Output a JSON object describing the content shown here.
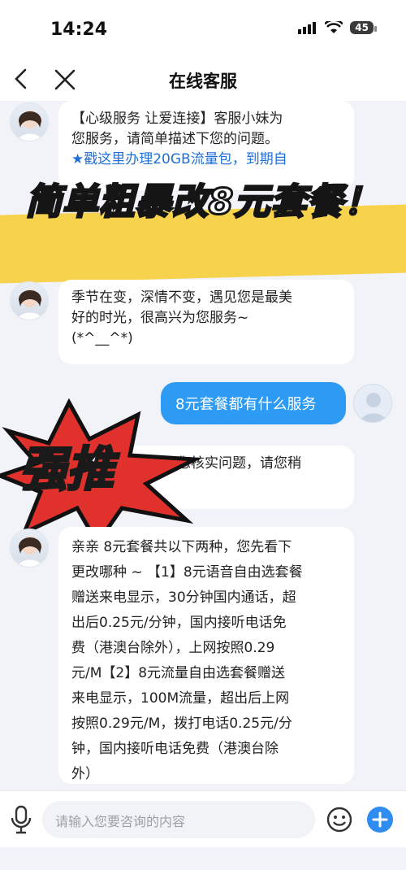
{
  "status": {
    "time": "14:24",
    "battery": "45"
  },
  "nav": {
    "title": "在线客服"
  },
  "messages": {
    "m1_line1": "【心级服务 让爱连接】客服小妹为",
    "m1_line2": "您服务，请简单描述下您的问题。",
    "m1_link": "★戳这里办理20GB流量包，到期自",
    "m2_line1": "季节在变，深情不变，遇见您是最美",
    "m2_line2": "好的时光，很高兴为您服务~",
    "m2_line3": "(*^__^*)",
    "user_msg": "8元套餐都有什么服务",
    "m3_line1": "您核实问题，请您稍",
    "m4_line1": "亲亲 8元套餐共以下两种，您先看下",
    "m4_line2": "更改哪种 ~ 【1】8元语音自由选套餐",
    "m4_line3": "赠送来电显示，30分钟国内通话，超",
    "m4_line4": "出后0.25元/分钟，国内接听电话免",
    "m4_line5": "费（港澳台除外），上网按照0.29",
    "m4_line6": "元/M【2】8元流量自由选套餐赠送",
    "m4_line7": "来电显示，100M流量，超出后上网",
    "m4_line8": "按照0.29元/M，拨打电话0.25元/分",
    "m4_line9": "钟，国内接听电话免费（港澳台除",
    "m4_line10": "外）"
  },
  "overlay": {
    "banner": "简单粗暴改8元套餐！",
    "sticker": "强推"
  },
  "input": {
    "placeholder": "请输入您要咨询的内容"
  },
  "colors": {
    "accent": "#2d9bf4",
    "banner": "#f6d24d",
    "sticker": "#e0312c"
  },
  "icons": [
    "back-icon",
    "close-icon",
    "mic-icon",
    "emoji-icon",
    "plus-icon",
    "wifi-icon",
    "signal-icon"
  ]
}
